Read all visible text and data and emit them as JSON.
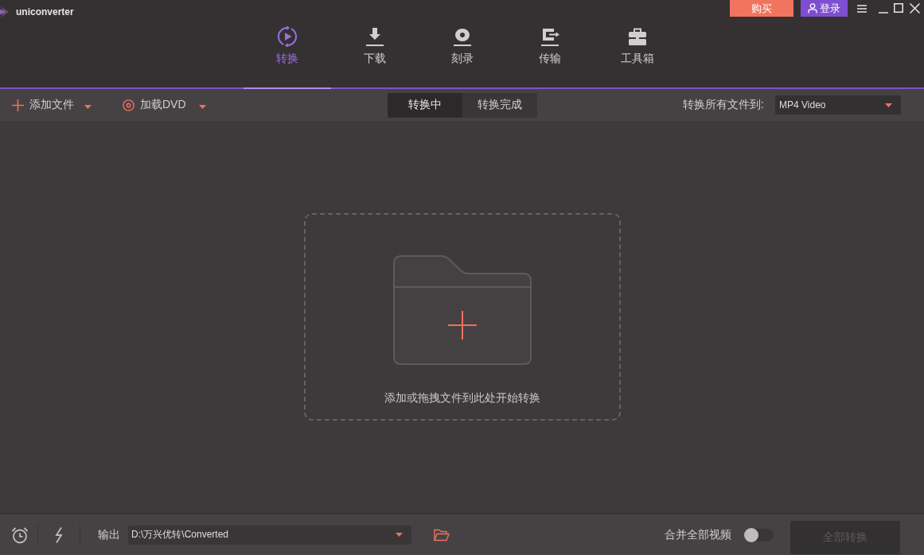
{
  "app": {
    "name": "uniconverter"
  },
  "header_buttons": [
    {
      "kind": "buy",
      "label": "购买"
    },
    {
      "kind": "login",
      "label": "登录"
    }
  ],
  "nav_tabs": [
    {
      "kind": "convert",
      "label": "转换",
      "selected": true
    },
    {
      "kind": "download",
      "label": "下载",
      "selected": false
    },
    {
      "kind": "burn",
      "label": "刻录",
      "selected": false
    },
    {
      "kind": "transfer",
      "label": "传输",
      "selected": false
    },
    {
      "kind": "toolbox",
      "label": "工具箱",
      "selected": false
    }
  ],
  "toolbar": {
    "add_file": "添加文件",
    "load_dvd": "加载DVD",
    "status_tabs": [
      {
        "label": "转换中",
        "selected": true
      },
      {
        "label": "转换完成",
        "selected": false
      }
    ],
    "convert_all_to_label": "转换所有文件到:",
    "output_format": "MP4 Video"
  },
  "drop_zone": {
    "hint": "添加或拖拽文件到此处开始转换"
  },
  "bottom_bar": {
    "output_label": "输出",
    "output_path": "D:\\万兴优转\\Converted",
    "merge_label": "合并全部视频",
    "merge_on": false,
    "convert_all": {
      "label": "全部转换",
      "disabled": true
    }
  }
}
